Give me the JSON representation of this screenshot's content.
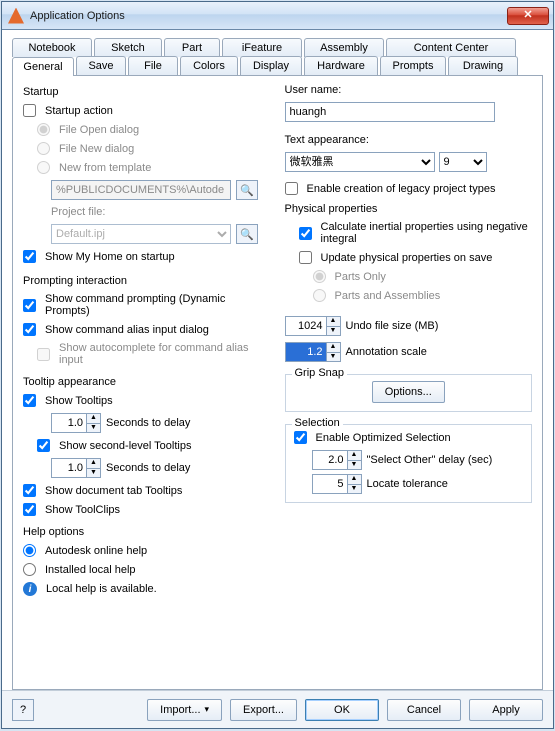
{
  "window": {
    "title": "Application Options",
    "close_glyph": "✕"
  },
  "tabs_top": [
    "Notebook",
    "Sketch",
    "Part",
    "iFeature",
    "Assembly",
    "Content Center"
  ],
  "tabs_bottom": [
    "General",
    "Save",
    "File",
    "Colors",
    "Display",
    "Hardware",
    "Prompts",
    "Drawing"
  ],
  "left": {
    "startup": {
      "title": "Startup",
      "startup_action": {
        "label": "Startup action",
        "checked": false
      },
      "file_open": {
        "label": "File Open dialog",
        "checked": true
      },
      "file_new": {
        "label": "File New dialog",
        "checked": false
      },
      "new_from_template": {
        "label": "New from template",
        "checked": false
      },
      "template_path": {
        "value": "%PUBLICDOCUMENTS%\\Autode"
      },
      "project_file_label": "Project file:",
      "project_file": {
        "value": "Default.ipj"
      },
      "show_home": {
        "label": "Show My Home on startup",
        "checked": true
      }
    },
    "prompting": {
      "title": "Prompting interaction",
      "command_prompting": {
        "label": "Show command prompting (Dynamic Prompts)",
        "checked": true
      },
      "alias_dialog": {
        "label": "Show command alias input dialog",
        "checked": true
      },
      "autocomplete": {
        "label": "Show autocomplete for command alias input",
        "checked": false
      }
    },
    "tooltip": {
      "title": "Tooltip appearance",
      "show_tooltips": {
        "label": "Show Tooltips",
        "checked": true
      },
      "delay1": {
        "value": "1.0",
        "label": "Seconds to delay"
      },
      "second_level": {
        "label": "Show second-level Tooltips",
        "checked": true
      },
      "delay2": {
        "value": "1.0",
        "label": "Seconds to delay"
      },
      "doc_tab": {
        "label": "Show document tab Tooltips",
        "checked": true
      },
      "toolclips": {
        "label": "Show ToolClips",
        "checked": true
      }
    },
    "help": {
      "title": "Help options",
      "online": {
        "label": "Autodesk online help",
        "checked": true
      },
      "local": {
        "label": "Installed local help",
        "checked": false
      },
      "info": "Local help is available."
    }
  },
  "right": {
    "username_label": "User name:",
    "username_value": "huangh",
    "text_appearance_label": "Text appearance:",
    "font_value": "微软雅黑",
    "font_size": "9",
    "enable_legacy": {
      "label": "Enable creation of legacy project types",
      "checked": false
    },
    "physical": {
      "title": "Physical properties",
      "calc_inertial": {
        "label": "Calculate inertial properties using negative integral",
        "checked": true
      },
      "update_on_save": {
        "label": "Update physical properties on save",
        "checked": false
      },
      "parts_only": {
        "label": "Parts Only",
        "checked": true
      },
      "parts_assemblies": {
        "label": "Parts and Assemblies",
        "checked": false
      }
    },
    "undo": {
      "value": "1024",
      "label": "Undo file size (MB)"
    },
    "annotation": {
      "value": "1.2",
      "label": "Annotation scale"
    },
    "grip_snap": {
      "title": "Grip Snap",
      "options_label": "Options..."
    },
    "selection": {
      "title": "Selection",
      "enable_optimized": {
        "label": "Enable Optimized Selection",
        "checked": true
      },
      "select_other": {
        "value": "2.0",
        "label": "\"Select Other\" delay (sec)"
      },
      "locate_tol": {
        "value": "5",
        "label": "Locate tolerance"
      }
    }
  },
  "footer": {
    "help_glyph": "?",
    "import": "Import...",
    "export": "Export...",
    "ok": "OK",
    "cancel": "Cancel",
    "apply": "Apply",
    "caret": "▾"
  },
  "icons": {
    "browse_glyph": "🔍",
    "spin_up": "▲",
    "spin_down": "▼"
  }
}
